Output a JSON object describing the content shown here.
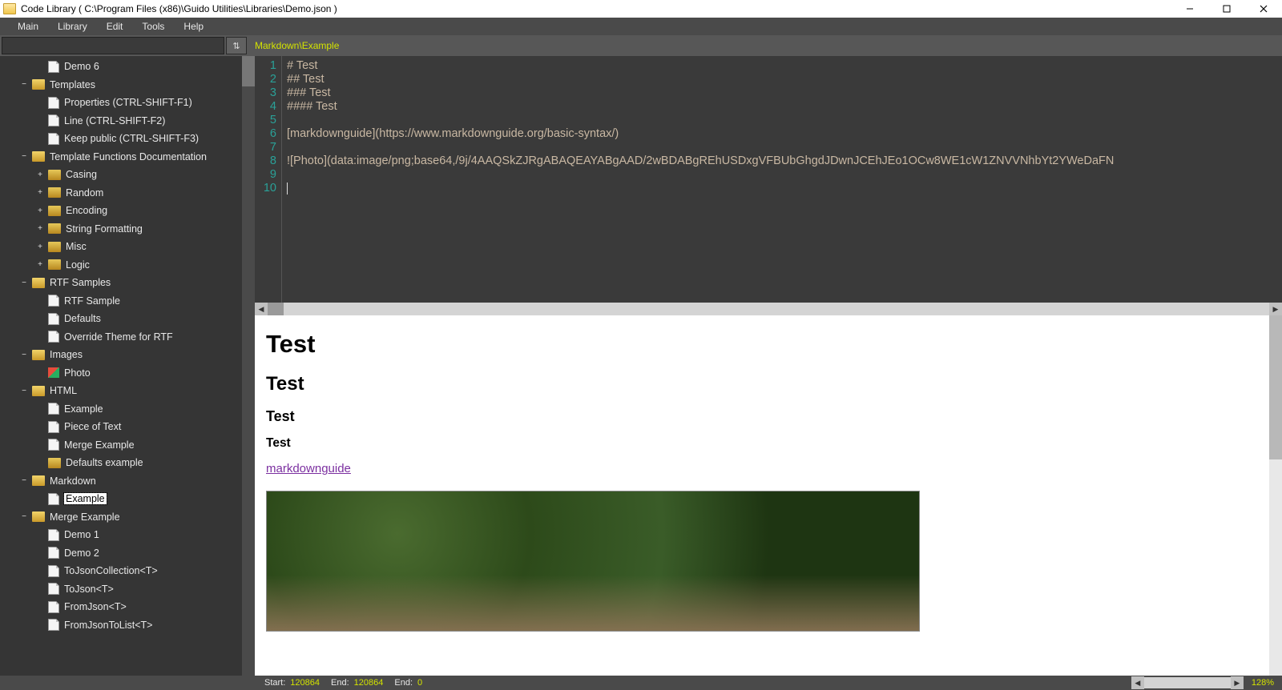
{
  "window": {
    "title": "Code Library ( C:\\Program Files (x86)\\Guido Utilities\\Libraries\\Demo.json )"
  },
  "menu": [
    "Main",
    "Library",
    "Edit",
    "Tools",
    "Help"
  ],
  "toolbar": {
    "search_value": "",
    "sort_icon": "sort-icon",
    "path": "Markdown\\Example"
  },
  "tree": [
    {
      "indent": 2,
      "type": "file",
      "label": "Demo 6"
    },
    {
      "indent": 1,
      "type": "folder",
      "expand": "−",
      "label": "Templates"
    },
    {
      "indent": 2,
      "type": "file",
      "label": "Properties (CTRL-SHIFT-F1)"
    },
    {
      "indent": 2,
      "type": "file",
      "label": "Line (CTRL-SHIFT-F2)"
    },
    {
      "indent": 2,
      "type": "file",
      "label": "Keep public (CTRL-SHIFT-F3)"
    },
    {
      "indent": 1,
      "type": "folder",
      "expand": "−",
      "label": "Template Functions Documentation"
    },
    {
      "indent": 2,
      "type": "folder-closed",
      "expand": "+",
      "label": "Casing"
    },
    {
      "indent": 2,
      "type": "folder-closed",
      "expand": "+",
      "label": "Random"
    },
    {
      "indent": 2,
      "type": "folder-closed",
      "expand": "+",
      "label": "Encoding"
    },
    {
      "indent": 2,
      "type": "folder-closed",
      "expand": "+",
      "label": "String Formatting"
    },
    {
      "indent": 2,
      "type": "folder-closed",
      "expand": "+",
      "label": "Misc"
    },
    {
      "indent": 2,
      "type": "folder-closed",
      "expand": "+",
      "label": "Logic"
    },
    {
      "indent": 1,
      "type": "folder",
      "expand": "−",
      "label": "RTF Samples"
    },
    {
      "indent": 2,
      "type": "file",
      "label": "RTF Sample"
    },
    {
      "indent": 2,
      "type": "file",
      "label": "Defaults"
    },
    {
      "indent": 2,
      "type": "file",
      "label": "Override Theme for RTF"
    },
    {
      "indent": 1,
      "type": "folder",
      "expand": "−",
      "label": "Images"
    },
    {
      "indent": 2,
      "type": "image",
      "label": "Photo"
    },
    {
      "indent": 1,
      "type": "folder",
      "expand": "−",
      "label": "HTML"
    },
    {
      "indent": 2,
      "type": "file",
      "label": "Example"
    },
    {
      "indent": 2,
      "type": "file",
      "label": "Piece of Text"
    },
    {
      "indent": 2,
      "type": "file",
      "label": "Merge Example"
    },
    {
      "indent": 2,
      "type": "folder-closed",
      "label": "Defaults example"
    },
    {
      "indent": 1,
      "type": "folder",
      "expand": "−",
      "label": "Markdown"
    },
    {
      "indent": 2,
      "type": "file",
      "label": "Example",
      "selected": true
    },
    {
      "indent": 1,
      "type": "folder",
      "expand": "−",
      "label": "Merge Example"
    },
    {
      "indent": 2,
      "type": "file",
      "label": "Demo 1"
    },
    {
      "indent": 2,
      "type": "file",
      "label": "Demo 2"
    },
    {
      "indent": 2,
      "type": "file",
      "label": "ToJsonCollection<T>"
    },
    {
      "indent": 2,
      "type": "file",
      "label": "ToJson<T>"
    },
    {
      "indent": 2,
      "type": "file",
      "label": "FromJson<T>"
    },
    {
      "indent": 2,
      "type": "file",
      "label": "FromJsonToList<T>"
    }
  ],
  "editor": {
    "line_numbers": [
      "1",
      "2",
      "3",
      "4",
      "5",
      "6",
      "7",
      "8",
      "9",
      "10"
    ],
    "lines": [
      "# Test",
      "## Test",
      "### Test",
      "#### Test",
      "",
      "[markdownguide](https://www.markdownguide.org/basic-syntax/)",
      "",
      "![Photo](data:image/png;base64,/9j/4AAQSkZJRgABAQEAYABgAAD/2wBDABgREhUSDxgVFBUbGhgdJDwnJCEhJEo1OCw8WE1cW1ZNVVNhbYt2YWeDaFN",
      "",
      ""
    ]
  },
  "preview": {
    "h1": "Test",
    "h2": "Test",
    "h3": "Test",
    "h4": "Test",
    "link_text": "markdownguide"
  },
  "status": {
    "start_label": "Start:",
    "start_value": "120864",
    "end_label": "End:",
    "end_value": "120864",
    "end2_label": "End:",
    "end2_value": "0",
    "zoom": "128%"
  }
}
